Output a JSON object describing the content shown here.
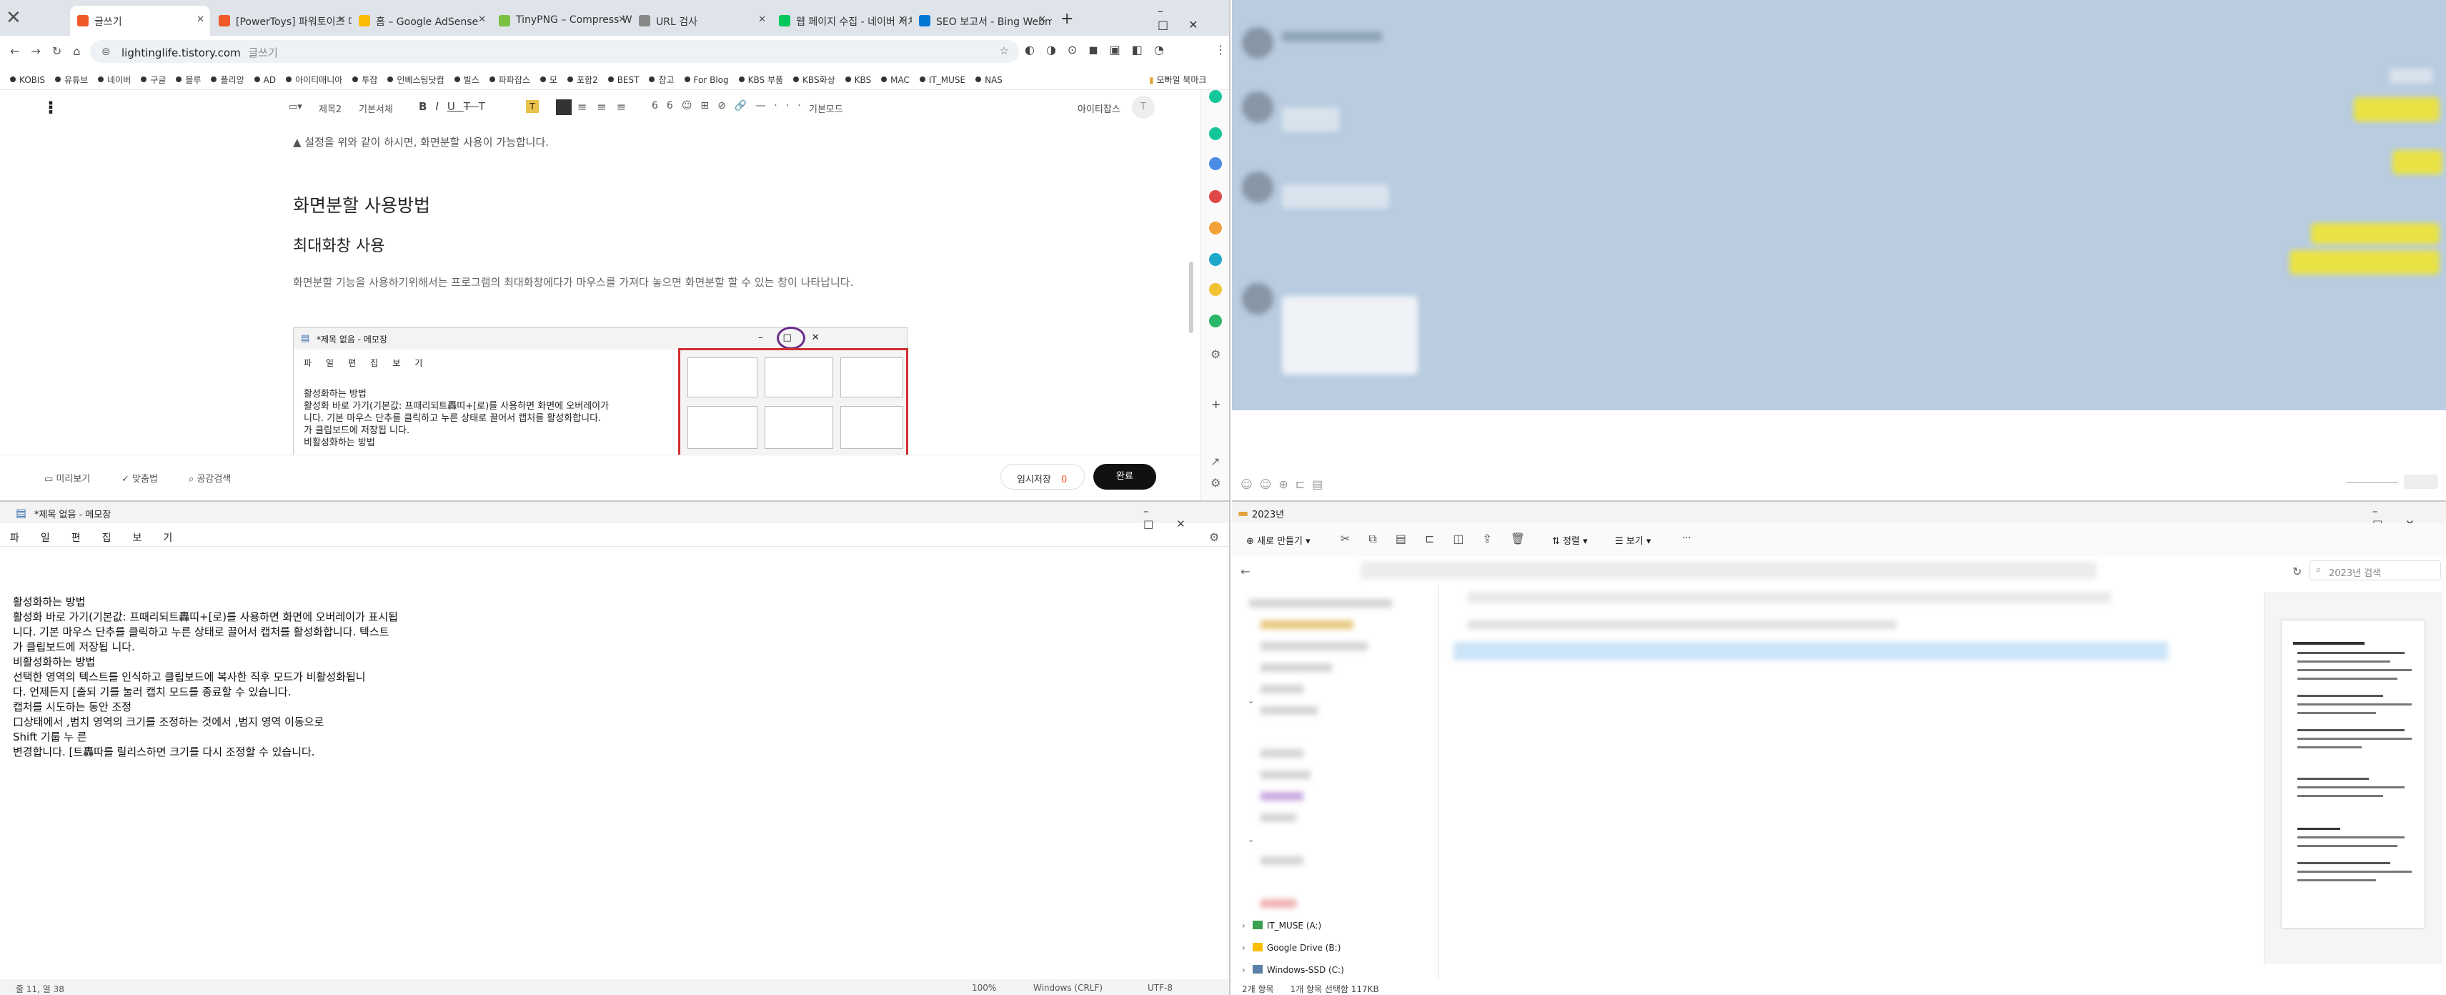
{
  "browser": {
    "tabs": [
      {
        "label": "글쓰기",
        "color": "#f05a28",
        "active": true
      },
      {
        "label": "[PowerToys] 파워토이즈 다운",
        "color": "#f05a28"
      },
      {
        "label": "홈 – Google AdSense",
        "color": "#fbbc04"
      },
      {
        "label": "TinyPNG – Compress WebP",
        "color": "#7ac143"
      },
      {
        "label": "URL 검사",
        "color": "#888888"
      },
      {
        "label": "웹 페이지 수집 - 네이버 서치",
        "color": "#03c75a"
      },
      {
        "label": "SEO 보고서 - Bing Webmaster",
        "color": "#0078d4"
      }
    ],
    "new_tab": "+",
    "url_host": "lightinglife.tistory.com",
    "url_path": "글쓰기",
    "bookmarks": [
      "KOBIS",
      "유튜브",
      "네이버",
      "구글",
      "블루",
      "플리앙",
      "AD",
      "아이티매니아",
      "투잡",
      "인베스팅닷컴",
      "빌스",
      "파파잡스",
      "모",
      "포함2",
      "BEST",
      "참고",
      "For Blog",
      "KBS 부품",
      "KBS화상",
      "KBS",
      "MAC",
      "IT_MUSE",
      "NAS"
    ],
    "bookmarks_more": "»",
    "bookmarks_mobile": "모바일 북마크"
  },
  "editor": {
    "heading_select": "제목2",
    "font_select": "기본서체",
    "mode_select": "기본모드",
    "user": "아이티잡스",
    "caption": "▲ 설정을 위와 같이 하시면, 화면분할 사용이 가능합니다.",
    "h2": "화면분할 사용방법",
    "h3": "최대화창 사용",
    "paragraph": "화면분할 기능을 사용하기위해서는 프로그램의 최대화창에다가 마우스를 가져다 놓으면 화면분할 할 수 있는 창이 나타납니다.",
    "embed": {
      "title": "*제목 없음 - 메모장",
      "menu": [
        "파일",
        "편집",
        "보기"
      ],
      "lines": [
        "활성화하는 방법",
        "활성화 바로 가기(기본값: 프때리되트轟띠+[로)를 사용하면 화면에 오버레이가",
        "니다. 기본 마우스 단추를 클릭하고 누른 상태로 끌어서 캡처를 활성화합니다.",
        "가 클립보드에 저장됩 니다.",
        "비활성화하는 방법"
      ]
    },
    "footer": {
      "preview": "미리보기",
      "spell": "맞춤법",
      "search": "공감검색",
      "temp_save": "임시저장",
      "temp_count": "0",
      "done": "완료"
    }
  },
  "notepad": {
    "title": "*제목 없음 - 메모장",
    "menu": [
      "파일",
      "편집",
      "보기"
    ],
    "lines": [
      "활성화하는 방법",
      "활성화 바로 가기(기본값: 프때리되트轟띠+[로)를 사용하면 화면에 오버레이가 표시됩",
      "니다. 기본 마우스 단추를 클릭하고 누른 상태로 끌어서 캡처를 활성화합니다. 텍스트",
      "가 클립보드에 저장됩 니다.",
      "비활성화하는 방법",
      "선택한 영역의 텍스트를 인식하고 클립보드에 복사한 직후 모드가 비활성화됩니",
      "다. 언제든지 [출되 기를 눌러 캡치 모드를 종료할 수 있습니다.",
      "캡처를 시도하는 동안 조정",
      "口상태에서 ,범치 영역의 크기를 조정하는 것에서 ,범지 영역 이동으로",
      "Shift 기룹 누 른",
      "변경합니다. [트轟따를 릴리스하면 크기를 다시 조정할 수 있습니다."
    ],
    "status": {
      "position": "줄 11, 열 38",
      "zoom": "100%",
      "eol": "Windows (CRLF)",
      "encoding": "UTF-8"
    }
  },
  "explorer": {
    "title": "2023년",
    "new_button": "새로 만들기",
    "sort": "정렬",
    "view": "보기",
    "more": "···",
    "search_placeholder": "2023년 검색",
    "drives": [
      {
        "label": "IT_MUSE (A:)",
        "color": "#3a9f4f"
      },
      {
        "label": "Google Drive (B:)",
        "color": "#fbbc04"
      },
      {
        "label": "Windows-SSD (C:)",
        "color": "#5a7fa6"
      }
    ],
    "status": "2개 항목      1개 항목 선택함 117KB"
  },
  "colors": {
    "accent": "#f05a28",
    "done_btn": "#111111",
    "chat_bg": "#b9cce0"
  }
}
